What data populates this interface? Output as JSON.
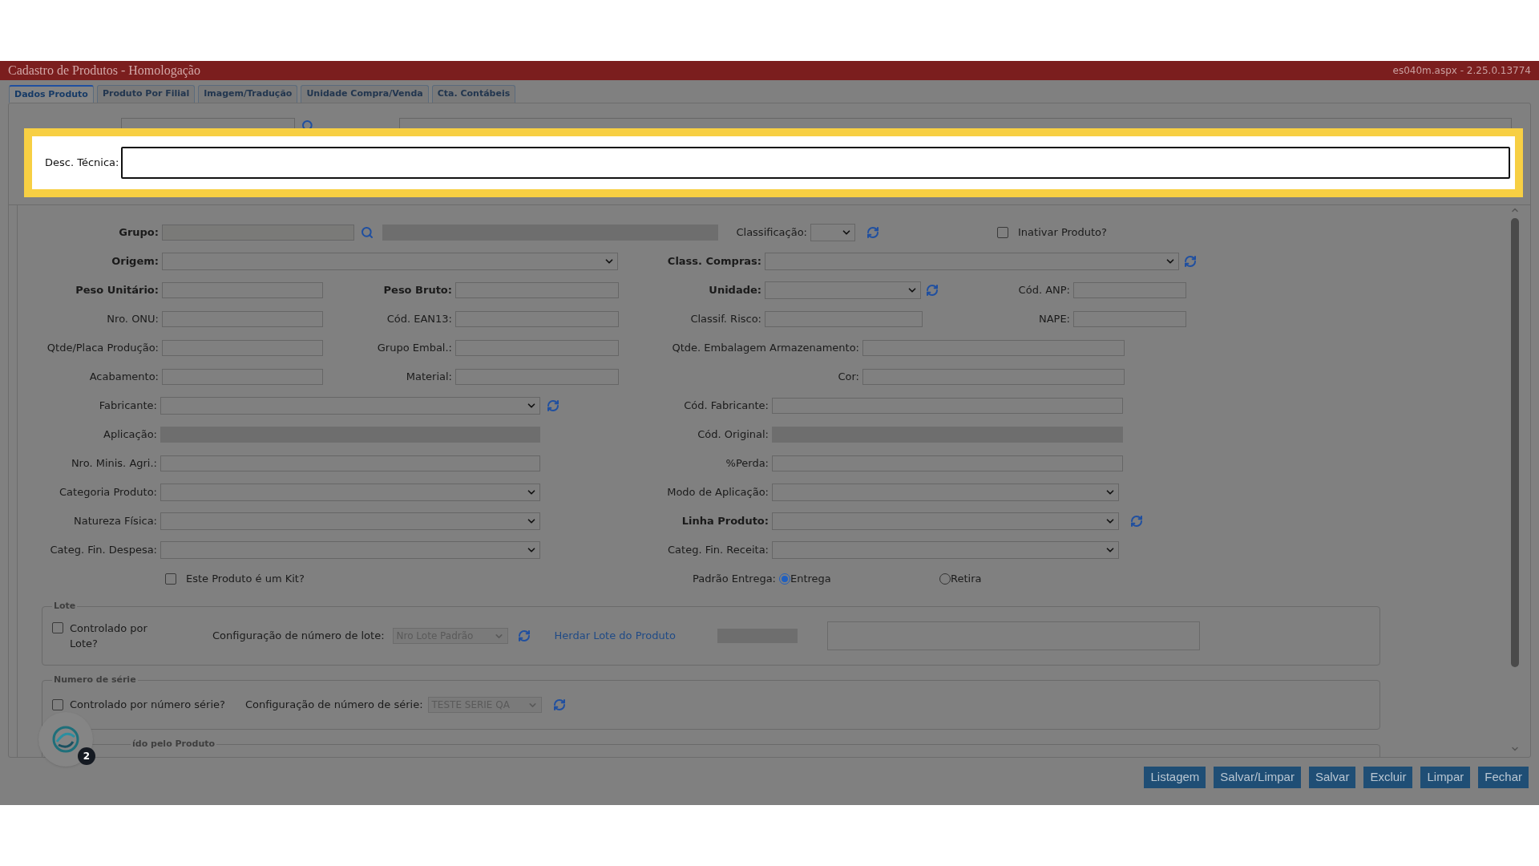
{
  "window": {
    "title": "Cadastro de Produtos  - Homologação",
    "version": "es040m.aspx - 2.25.0.13774"
  },
  "tabs": [
    {
      "label": "Dados Produto",
      "selected": true
    },
    {
      "label": "Produto Por Filial",
      "selected": false
    },
    {
      "label": "Imagem/Tradução",
      "selected": false
    },
    {
      "label": "Unidade Compra/Venda",
      "selected": false
    },
    {
      "label": "Cta. Contábeis",
      "selected": false
    }
  ],
  "highlight": {
    "label": "Desc. Técnica:"
  },
  "fields": [
    {
      "label": "Grupo:",
      "kind": "lookup",
      "required": true
    },
    {
      "label": "Classificação:",
      "kind": "select",
      "required": false
    },
    {
      "label": "Origem:",
      "kind": "select",
      "required": true
    },
    {
      "label": "Class. Compras:",
      "kind": "select",
      "required": true
    },
    {
      "label": "Peso Unitário:",
      "kind": "text",
      "required": true
    },
    {
      "label": "Peso Bruto:",
      "kind": "text",
      "required": true
    },
    {
      "label": "Unidade:",
      "kind": "select",
      "required": true
    },
    {
      "label": "Cód. ANP:",
      "kind": "text",
      "required": false
    },
    {
      "label": "Nro. ONU:",
      "kind": "text",
      "required": false
    },
    {
      "label": "Cód. EAN13:",
      "kind": "text",
      "required": false
    },
    {
      "label": "Classif. Risco:",
      "kind": "text",
      "required": false
    },
    {
      "label": "NAPE:",
      "kind": "text",
      "required": false
    },
    {
      "label": "Qtde/Placa Produção:",
      "kind": "text",
      "required": false
    },
    {
      "label": "Grupo Embal.:",
      "kind": "text",
      "required": false
    },
    {
      "label": "Qtde. Embalagem Armazenamento:",
      "kind": "text",
      "required": false
    },
    {
      "label": "Acabamento:",
      "kind": "text",
      "required": false
    },
    {
      "label": "Material:",
      "kind": "text",
      "required": false
    },
    {
      "label": "Cor:",
      "kind": "text",
      "required": false
    },
    {
      "label": "Fabricante:",
      "kind": "select",
      "required": false
    },
    {
      "label": "Cód. Fabricante:",
      "kind": "text",
      "required": false
    },
    {
      "label": "Aplicação:",
      "kind": "readonly",
      "required": false
    },
    {
      "label": "Cód. Original:",
      "kind": "readonly",
      "required": false
    },
    {
      "label": "Nro. Minis. Agri.:",
      "kind": "text",
      "required": false
    },
    {
      "label": "%Perda:",
      "kind": "text",
      "required": false
    },
    {
      "label": "Categoria Produto:",
      "kind": "select",
      "required": false
    },
    {
      "label": "Modo de Aplicação:",
      "kind": "select",
      "required": false
    },
    {
      "label": "Natureza Física:",
      "kind": "select",
      "required": false
    },
    {
      "label": "Linha Produto:",
      "kind": "select",
      "required": true
    },
    {
      "label": "Categ. Fin. Despesa:",
      "kind": "select",
      "required": false
    },
    {
      "label": "Categ. Fin. Receita:",
      "kind": "select",
      "required": false
    }
  ],
  "inativar": {
    "label": "Inativar Produto?",
    "checked": false
  },
  "kit": {
    "label": "Este Produto é um Kit?",
    "checked": false
  },
  "padrao_entrega": {
    "label": "Padrão Entrega:",
    "options": [
      {
        "label": "Entrega",
        "selected": true
      },
      {
        "label": "Retira",
        "selected": false
      }
    ]
  },
  "lote": {
    "legend": "Lote",
    "checkbox": {
      "label": "Controlado por Lote?",
      "checked": false
    },
    "config_label": "Configuração de número de lote:",
    "config_value": "Nro Lote Padrão",
    "disabled": true,
    "link": "Herdar Lote do Produto"
  },
  "numero_serie": {
    "legend": "Numero de série",
    "checkbox": {
      "label": "Controlado por número série?",
      "checked": false
    },
    "config_label": "Configuração de número de série:",
    "config_value": "TESTE SERIE QA",
    "disabled": true
  },
  "third_section": {
    "legend": "ído pelo Produto"
  },
  "chat_badge": "2",
  "buttons": [
    "Listagem",
    "Salvar/Limpar",
    "Salvar",
    "Excluir",
    "Limpar",
    "Fechar"
  ]
}
